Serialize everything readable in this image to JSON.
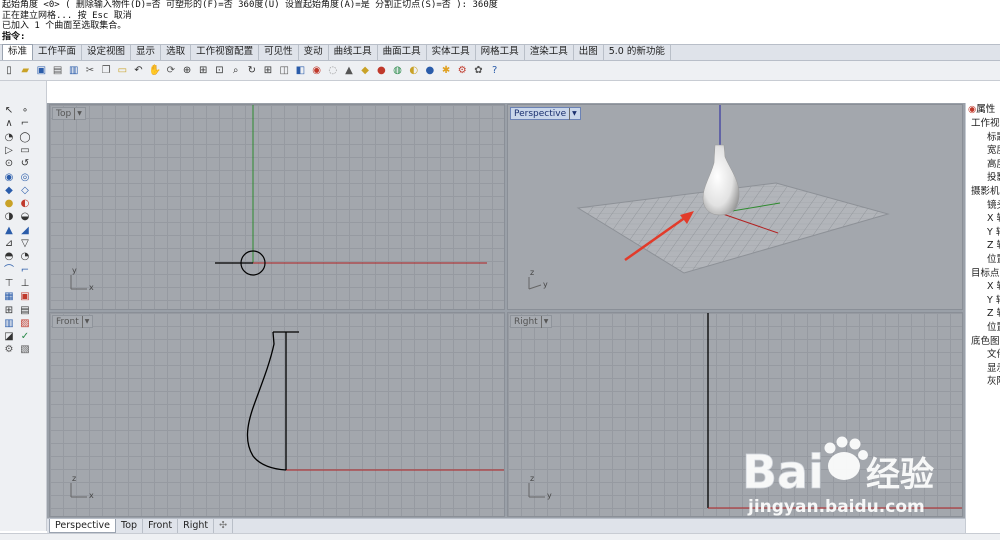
{
  "command": {
    "lines": [
      "起始角度 <0> ( 删除输入物件(D)=否  可塑形的(F)=否  360度(U)  设置起始角度(A)=是  分割正切点(S)=否 ): 360度",
      "正在建立网格... 按 Esc 取消",
      "已加入 1 个曲面至选取集合。"
    ],
    "prompt": "指令:"
  },
  "ribbon_tabs": [
    "标准",
    "工作平面",
    "设定视图",
    "显示",
    "选取",
    "工作视窗配置",
    "可见性",
    "变动",
    "曲线工具",
    "曲面工具",
    "实体工具",
    "网格工具",
    "渲染工具",
    "出图",
    "5.0 的新功能"
  ],
  "active_tab": "标准",
  "toolbar_icons": [
    "new-icon",
    "open-icon",
    "save-icon",
    "print-icon",
    "import-icon",
    "cut-icon",
    "copy-icon",
    "paste-icon",
    "undo-icon",
    "pan-icon",
    "rotate-view-icon",
    "zoom-icon",
    "zoom-window-icon",
    "zoom-extents-icon",
    "zoom-selected-icon",
    "rotate-icon",
    "four-views-icon",
    "cplane-icon",
    "set-view-icon",
    "show-icon",
    "hide-icon",
    "lock-icon",
    "layer-icon",
    "render-icon",
    "material-icon",
    "environment-icon",
    "sphere-icon",
    "light-icon",
    "options-icon",
    "settings-icon",
    "help-icon"
  ],
  "viewports": {
    "top": {
      "label": "Top"
    },
    "perspective": {
      "label": "Perspective"
    },
    "front": {
      "label": "Front"
    },
    "right": {
      "label": "Right"
    }
  },
  "axis_labels": {
    "x": "x",
    "y": "y",
    "z": "z"
  },
  "viewport_tabs": [
    "Perspective",
    "Top",
    "Front",
    "Right"
  ],
  "active_viewport_tab": "Perspective",
  "properties": {
    "header": "属性",
    "rows": [
      {
        "kind": "sec",
        "text": "工作视窗"
      },
      {
        "kind": "item",
        "text": "标题"
      },
      {
        "kind": "item",
        "text": "宽度"
      },
      {
        "kind": "item",
        "text": "高度"
      },
      {
        "kind": "item",
        "text": "投影"
      },
      {
        "kind": "sec",
        "text": "摄影机"
      },
      {
        "kind": "item",
        "text": "镜头"
      },
      {
        "kind": "item",
        "text": "X 轴"
      },
      {
        "kind": "item",
        "text": "Y 轴"
      },
      {
        "kind": "item",
        "text": "Z 轴"
      },
      {
        "kind": "item",
        "text": "位置"
      },
      {
        "kind": "sec",
        "text": "目标点"
      },
      {
        "kind": "item",
        "text": "X 轴"
      },
      {
        "kind": "item",
        "text": "Y 轴"
      },
      {
        "kind": "item",
        "text": "Z 轴"
      },
      {
        "kind": "item",
        "text": "位置"
      },
      {
        "kind": "sec",
        "text": "底色图"
      },
      {
        "kind": "item",
        "text": "文件"
      },
      {
        "kind": "item",
        "text": "显示"
      },
      {
        "kind": "item",
        "text": "灰阶"
      }
    ]
  },
  "watermark": {
    "brand": "Bai",
    "brand2": "经验",
    "url": "jingyan.baidu.com"
  },
  "colors": {
    "axis_x": "#b22222",
    "axis_y": "#2e8b2e",
    "axis_z": "#2020a0",
    "arrow": "#e23b2a",
    "accent": "#1a2f6e"
  }
}
